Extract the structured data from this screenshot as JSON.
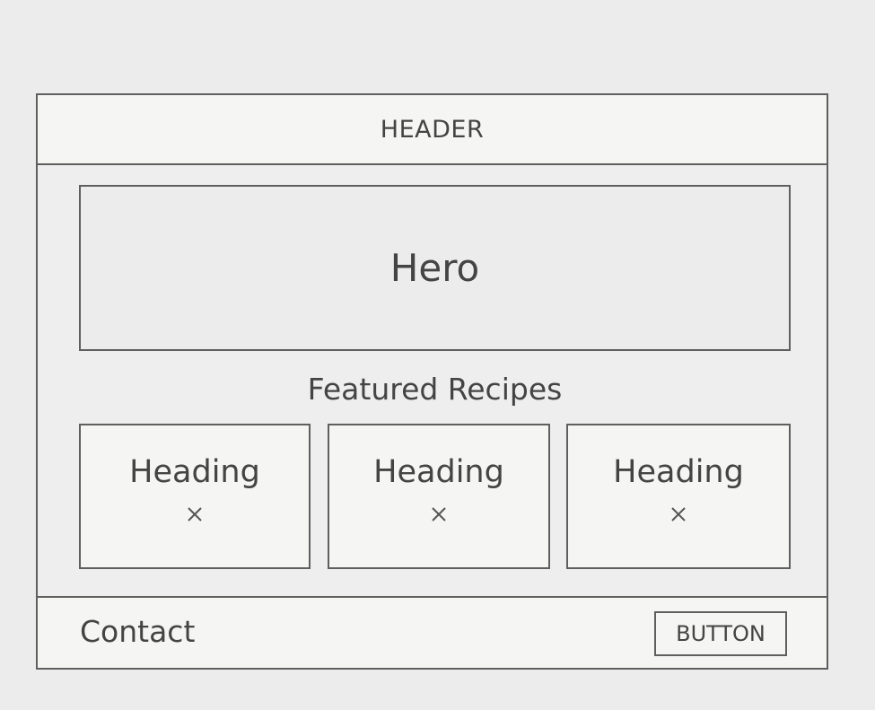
{
  "header": {
    "title": "HEADER"
  },
  "hero": {
    "label": "Hero"
  },
  "featured": {
    "title": "Featured Recipes",
    "cards": [
      {
        "heading": "Heading",
        "icon": "close-icon"
      },
      {
        "heading": "Heading",
        "icon": "close-icon"
      },
      {
        "heading": "Heading",
        "icon": "close-icon"
      }
    ]
  },
  "footer": {
    "contact_label": "Contact",
    "button_label": "BUTTON"
  },
  "colors": {
    "page_background": "#ececec",
    "panel_background": "#f5f5f3",
    "stroke": "#5f5f5f",
    "text": "#444444"
  }
}
